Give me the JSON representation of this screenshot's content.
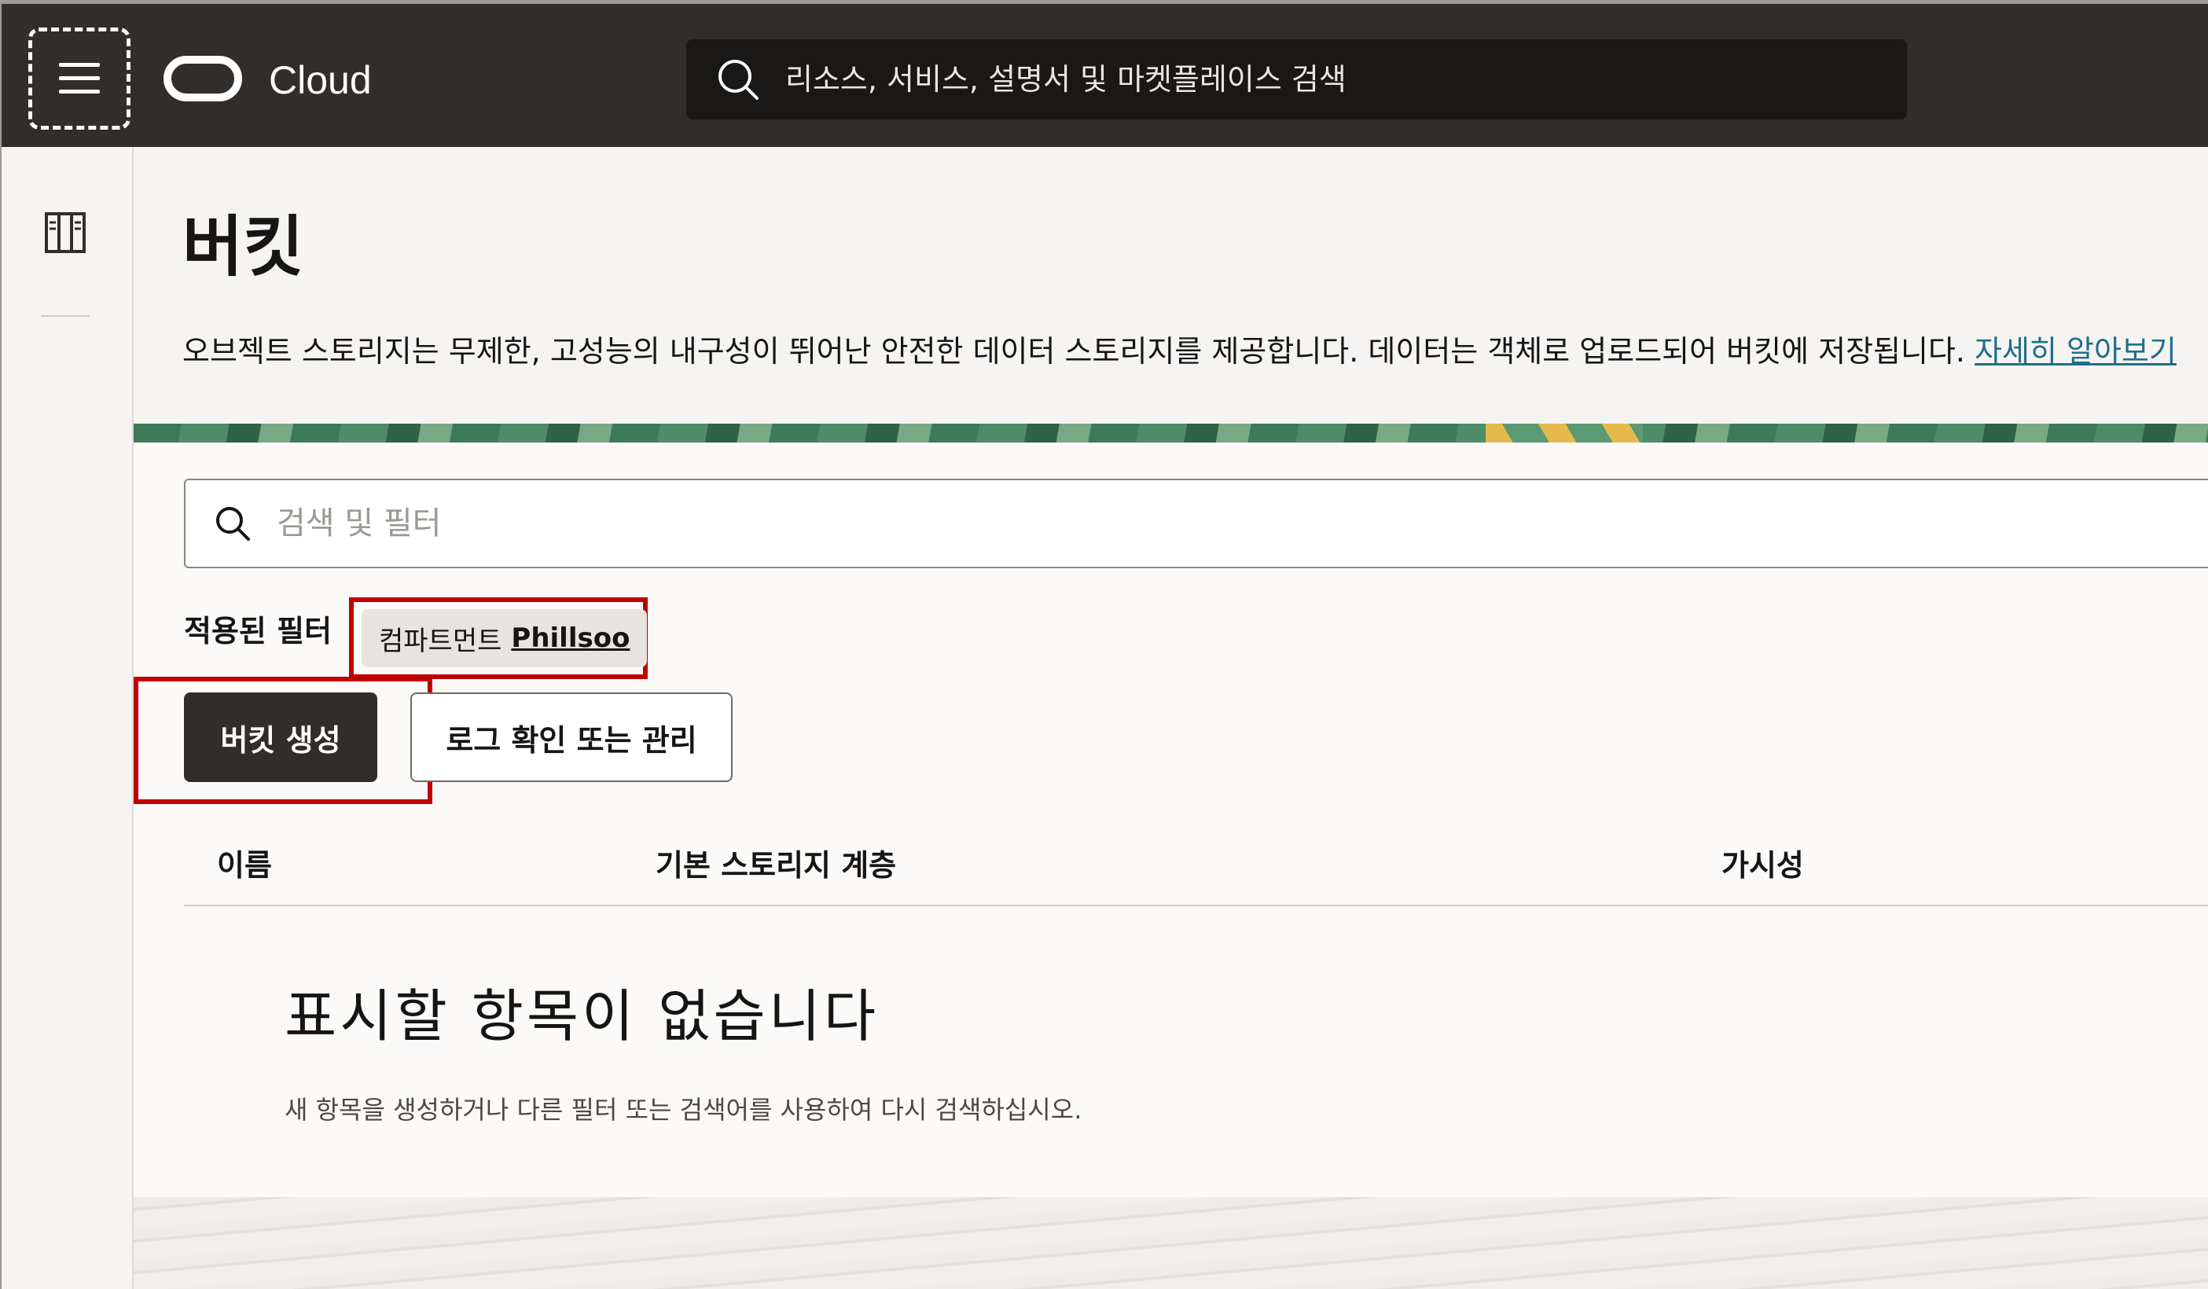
{
  "header": {
    "brand": "Cloud",
    "search_placeholder": "리소스, 서비스, 설명서 및 마켓플레이스 검색",
    "menu_icon": "hamburger-icon",
    "search_icon": "search-icon"
  },
  "sidebar": {
    "icon": "panel-columns-icon"
  },
  "page": {
    "title": "버킷",
    "description": "오브젝트 스토리지는 무제한, 고성능의 내구성이 뛰어난 안전한 데이터 스토리지를 제공합니다. 데이터는 객체로 업로드되어 버킷에 저장됩니다.",
    "learn_more": "자세히 알아보기"
  },
  "filter": {
    "search_placeholder": "검색 및 필터",
    "applied_label": "적용된 필터",
    "chip_label": "컴파트먼트",
    "chip_value": "Phillsoo"
  },
  "actions": {
    "create_bucket": "버킷 생성",
    "logs": "로그 확인 또는 관리"
  },
  "table": {
    "columns": [
      "이름",
      "기본 스토리지 계층",
      "가시성"
    ]
  },
  "empty_state": {
    "title": "표시할 항목이 없습니다",
    "description": "새 항목을 생성하거나 다른 필터 또는 검색어를 사용하여 다시 검색하십시오."
  },
  "colors": {
    "header_bg": "#312d2a",
    "highlight": "#c00000",
    "link": "#1f6e8c"
  }
}
